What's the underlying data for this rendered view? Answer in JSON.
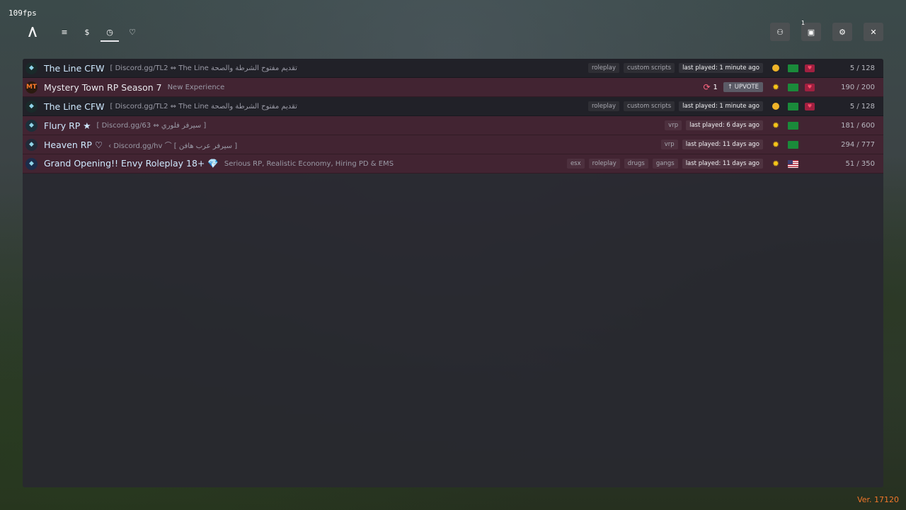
{
  "overlay": {
    "fps": "109fps",
    "version": "Ver. 17120"
  },
  "nav": {
    "tabs": [
      {
        "icon": "list-icon",
        "glyph": "≡"
      },
      {
        "icon": "dollar-icon",
        "glyph": "$"
      },
      {
        "icon": "clock-icon",
        "glyph": "◷"
      },
      {
        "icon": "heart-icon",
        "glyph": "♡"
      }
    ],
    "active_tab": 2
  },
  "top_right": {
    "buttons": [
      {
        "icon": "user-icon",
        "glyph": "⚇"
      },
      {
        "icon": "queue-icon",
        "glyph": "▣",
        "badge": "1"
      },
      {
        "icon": "gear-icon",
        "glyph": "⚙"
      },
      {
        "icon": "close-icon",
        "glyph": "✕"
      }
    ]
  },
  "servers": [
    {
      "name": "The Line CFW",
      "desc": "[ Discord.gg/TL2 ⇔ The Line تقديم مفتوح الشرطة والصحة",
      "tags": [
        "roleplay",
        "custom scripts"
      ],
      "last_played": "last played: 1 minute ago",
      "players": "5 / 128",
      "premium": false,
      "status": "dot",
      "flag": "sa",
      "fav": true
    },
    {
      "name": "Mystery Town RP Season 7",
      "desc": "New Experience",
      "tags": [],
      "boost_count": "1",
      "upvote": "UPVOTE",
      "last_played": "",
      "players": "190 / 200",
      "premium": true,
      "status": "sun",
      "flag": "sa",
      "fav": true
    },
    {
      "name": "The Line CFW",
      "desc": "[ Discord.gg/TL2 ⇔ The Line تقديم مفتوح الشرطة والصحة",
      "tags": [
        "roleplay",
        "custom scripts"
      ],
      "last_played": "last played: 1 minute ago",
      "players": "5 / 128",
      "premium": false,
      "status": "dot",
      "flag": "sa",
      "fav": true
    },
    {
      "name": "Flury RP ★",
      "desc": "[ Discord.gg/63 ⇔ سيرفر فلوري ]",
      "tags": [
        "vrp"
      ],
      "last_played": "last played: 6 days ago",
      "players": "181 / 600",
      "premium": true,
      "status": "sun",
      "flag": "sa",
      "fav": false
    },
    {
      "name": "Heaven RP ♡",
      "desc": "‹ Discord.gg/hv ⌒ [ سيرفر عرب هافن ]",
      "tags": [
        "vrp"
      ],
      "last_played": "last played: 11 days ago",
      "players": "294 / 777",
      "premium": true,
      "status": "sun",
      "flag": "sa",
      "fav": false
    },
    {
      "name": "Grand Opening!! Envy Roleplay 18+ 💎",
      "desc": "Serious RP, Realistic Economy, Hiring PD & EMS",
      "tags": [
        "esx",
        "roleplay",
        "drugs",
        "gangs"
      ],
      "last_played": "last played: 11 days ago",
      "players": "51 / 350",
      "premium": true,
      "status": "sun",
      "flag": "us",
      "fav": false
    }
  ],
  "colors": {
    "premium_row": "#46232f",
    "accent": "#cfe9ff",
    "version": "#f0762a"
  }
}
